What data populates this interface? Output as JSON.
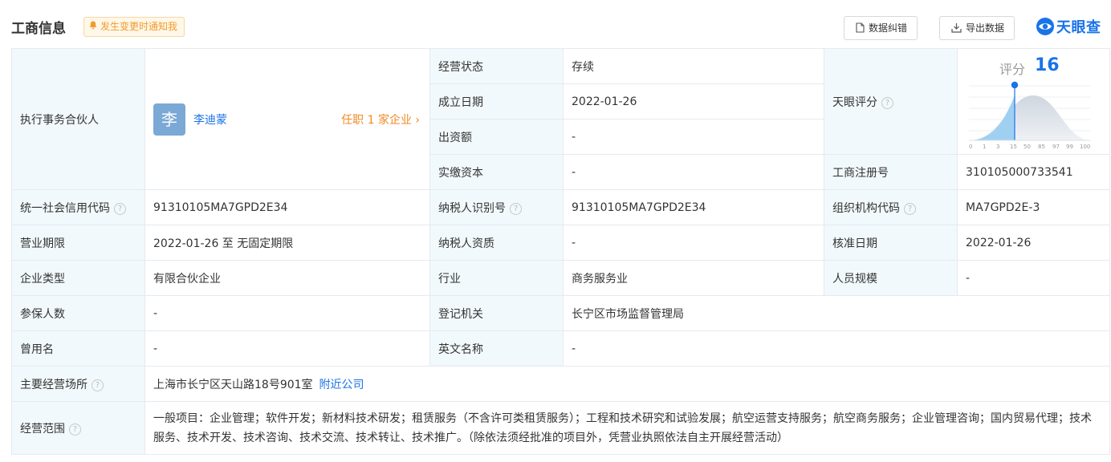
{
  "header": {
    "title": "工商信息",
    "notify_label": "发生变更时通知我",
    "correct_label": "数据纠错",
    "export_label": "导出数据",
    "logo_text": "天眼查"
  },
  "partner": {
    "label": "执行事务合伙人",
    "avatar_char": "李",
    "name": "李迪蒙",
    "jobs": "任职 1 家企业 ›"
  },
  "status": {
    "label": "经营状态",
    "value": "存续"
  },
  "established": {
    "label": "成立日期",
    "value": "2022-01-26"
  },
  "contribution": {
    "label": "出资额",
    "value": "-"
  },
  "paid_capital": {
    "label": "实缴资本",
    "value": "-"
  },
  "tianyan_score": {
    "label": "天眼评分",
    "score_label": "评分",
    "score": "16",
    "scale_ticks": [
      "0",
      "1",
      "3",
      "15",
      "50",
      "85",
      "97",
      "99",
      "100"
    ]
  },
  "reg_number": {
    "label": "工商注册号",
    "value": "310105000733541"
  },
  "credit_code": {
    "label": "统一社会信用代码",
    "value": "91310105MA7GPD2E34"
  },
  "taxpayer_id": {
    "label": "纳税人识别号",
    "value": "91310105MA7GPD2E34"
  },
  "org_code": {
    "label": "组织机构代码",
    "value": "MA7GPD2E-3"
  },
  "term": {
    "label": "营业期限",
    "value": "2022-01-26 至 无固定期限"
  },
  "taxpayer_qual": {
    "label": "纳税人资质",
    "value": "-"
  },
  "approval_date": {
    "label": "核准日期",
    "value": "2022-01-26"
  },
  "company_type": {
    "label": "企业类型",
    "value": "有限合伙企业"
  },
  "industry": {
    "label": "行业",
    "value": "商务服务业"
  },
  "staff_size": {
    "label": "人员规模",
    "value": "-"
  },
  "insured": {
    "label": "参保人数",
    "value": "-"
  },
  "authority": {
    "label": "登记机关",
    "value": "长宁区市场监督管理局"
  },
  "former_name": {
    "label": "曾用名",
    "value": "-"
  },
  "english_name": {
    "label": "英文名称",
    "value": "-"
  },
  "address": {
    "label": "主要经营场所",
    "value": "上海市长宁区天山路18号901室",
    "nearby": "附近公司"
  },
  "scope": {
    "label": "经营范围",
    "value": "一般项目：企业管理；软件开发；新材料技术研发；租赁服务（不含许可类租赁服务）；工程和技术研究和试验发展；航空运营支持服务；航空商务服务；企业管理咨询；国内贸易代理；技术服务、技术开发、技术咨询、技术交流、技术转让、技术推广。（除依法须经批准的项目外，凭营业执照依法自主开展经营活动）"
  },
  "colors": {
    "accent": "#1a73e8",
    "label_bg": "#f2f9fc",
    "orange": "#f08a24"
  }
}
